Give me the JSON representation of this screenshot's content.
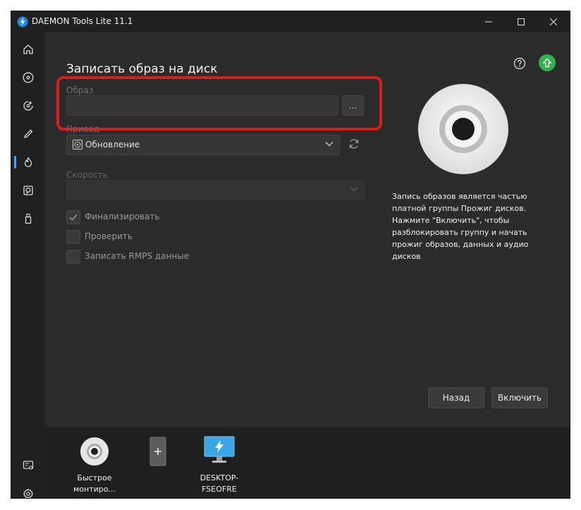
{
  "window": {
    "title": "DAEMON Tools Lite 11.1"
  },
  "sidebar": {
    "items": [
      {
        "name": "home",
        "icon": "home-icon"
      },
      {
        "name": "images",
        "icon": "disc-icon"
      },
      {
        "name": "new-image",
        "icon": "disc-add-icon"
      },
      {
        "name": "editor",
        "icon": "pencil-icon"
      },
      {
        "name": "burn",
        "icon": "flame-icon",
        "active": true
      },
      {
        "name": "virtual-hdd",
        "icon": "hdd-icon"
      },
      {
        "name": "usb",
        "icon": "usb-icon"
      }
    ],
    "bottom_items": [
      {
        "name": "license",
        "icon": "license-icon"
      },
      {
        "name": "settings",
        "icon": "gear-icon"
      }
    ]
  },
  "page": {
    "title": "Записать образ на диск",
    "image_label": "Образ",
    "image_value": "",
    "browse_label": "...",
    "drive_label": "Привод",
    "drive_value": "Обновление",
    "speed_label": "Скорость",
    "speed_value": "",
    "checkboxes": [
      {
        "label": "Финализировать",
        "checked": true
      },
      {
        "label": "Проверить",
        "checked": false
      },
      {
        "label": "Записать RMPS данные",
        "checked": false
      }
    ],
    "info_text": "Запись образов является частью платной группы Прожиг дисков. Нажмите \"Включить\", чтобы разблокировать группу и начать прожиг образов, данных и аудио дисков",
    "back_button": "Назад",
    "enable_button": "Включить"
  },
  "devices": [
    {
      "label": "Быстрое монтиро...",
      "icon": "disc-icon"
    },
    {
      "label": "",
      "icon": "add-device-icon"
    },
    {
      "label": "DESKTOP-FSEOFRE",
      "icon": "monitor-icon"
    }
  ],
  "colors": {
    "accent": "#4fa3e8",
    "highlight": "#d81d1d",
    "upgrade": "#2fb24a"
  }
}
